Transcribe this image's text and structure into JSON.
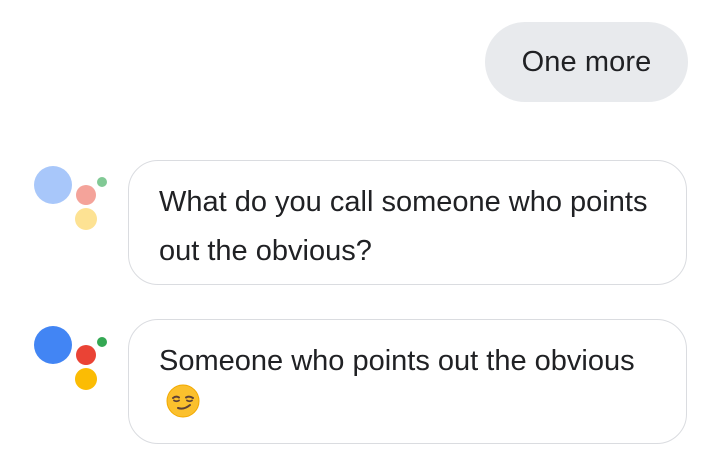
{
  "conversation": {
    "user_message": "One more",
    "assistant_messages": [
      {
        "text": "What do you call someone who points out the obvious?",
        "emoji": ""
      },
      {
        "text": "Someone who points out the obvious",
        "emoji": "smirking-face"
      }
    ]
  },
  "assistant_logo": {
    "icon": "google-assistant-icon",
    "colors_faded": [
      "#a8c7fa",
      "#f4a39a",
      "#fde293",
      "#81c995"
    ],
    "colors_active": [
      "#4285f4",
      "#ea4335",
      "#fbbc04",
      "#34a853"
    ]
  }
}
